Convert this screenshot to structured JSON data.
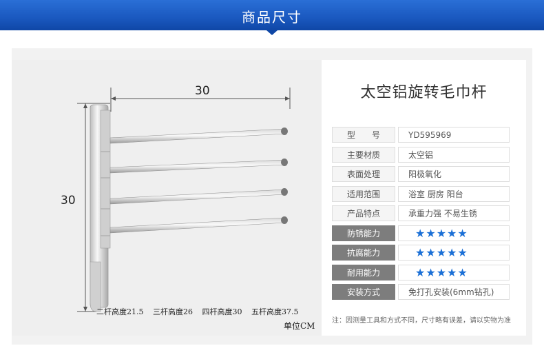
{
  "banner": {
    "title": "商品尺寸"
  },
  "product": {
    "title": "太空铝旋转毛巾杆"
  },
  "dimensions": {
    "width": "30",
    "height": "30",
    "unit": "单位CM"
  },
  "heights": [
    "二杆高度21.5",
    "三杆高度26",
    "四杆高度30",
    "五杆高度37.5"
  ],
  "specs": [
    {
      "label": "型　　号",
      "value": "YD595969"
    },
    {
      "label": "主要材质",
      "value": "太空铝"
    },
    {
      "label": "表面处理",
      "value": "阳极氧化"
    },
    {
      "label": "适用范围",
      "value": "浴室 厨房 阳台"
    },
    {
      "label": "产品特点",
      "value": "承重力强 不易生锈"
    },
    {
      "label": "防锈能力",
      "value": "★★★★★"
    },
    {
      "label": "抗腐能力",
      "value": "★★★★★"
    },
    {
      "label": "耐用能力",
      "value": "★★★★★"
    },
    {
      "label": "安装方式",
      "value": "免打孔安装(6mm钻孔)"
    }
  ],
  "note": "注：因测量工具和方式不同，尺寸略有误差，请以实物为准",
  "colors": {
    "banner": "#1a58bf",
    "star": "#1a6fd6",
    "dark_label": "#7d7d7d"
  }
}
